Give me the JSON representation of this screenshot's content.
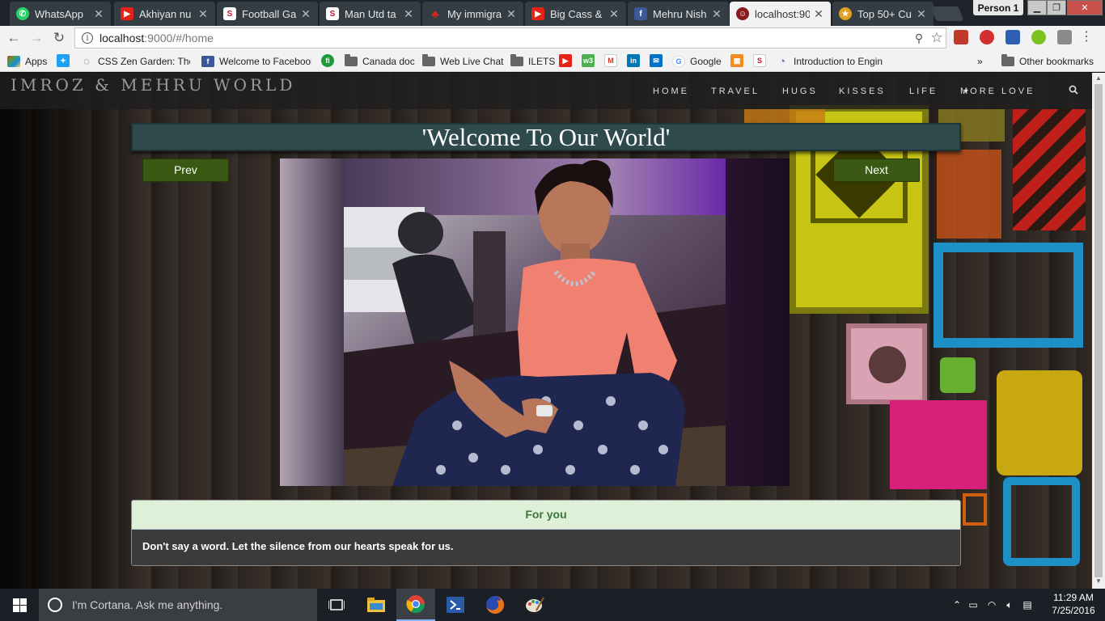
{
  "browser": {
    "tabs": [
      {
        "title": "WhatsApp",
        "icon": "whatsapp-icon",
        "color": "#25d366"
      },
      {
        "title": "Akhiyan nu",
        "icon": "youtube-icon",
        "color": "#e62117"
      },
      {
        "title": "Football Ga",
        "icon": "s-logo-icon",
        "color": "#c4122e"
      },
      {
        "title": "Man Utd ta",
        "icon": "s-logo-icon",
        "color": "#c4122e"
      },
      {
        "title": "My immigra",
        "icon": "maple-leaf-icon",
        "color": "#d52b1e"
      },
      {
        "title": "Big Cass &",
        "icon": "youtube-icon",
        "color": "#e62117"
      },
      {
        "title": "Mehru Nish",
        "icon": "facebook-icon",
        "color": "#3b5998"
      },
      {
        "title": "localhost:90",
        "icon": "site-icon",
        "color": "#8b1a1a"
      },
      {
        "title": "Top 50+ Cu",
        "icon": "star-badge-icon",
        "color": "#e0a020"
      }
    ],
    "profile": "Person 1",
    "url_host": "localhost",
    "url_rest": ":9000/#/home",
    "bookmarks": [
      {
        "label": "Apps",
        "icon": "apps-grid-icon"
      },
      {
        "label": "",
        "icon": "twitter-icon"
      },
      {
        "label": "CSS Zen Garden: The",
        "icon": "zen-icon"
      },
      {
        "label": "Welcome to Facebook",
        "icon": "facebook-icon"
      },
      {
        "label": "",
        "icon": "fi-icon"
      },
      {
        "label": "Canada doc",
        "icon": "folder-icon"
      },
      {
        "label": "Web Live Chat",
        "icon": "folder-icon"
      },
      {
        "label": "ILETS",
        "icon": "folder-icon"
      },
      {
        "label": "Google",
        "icon": "google-icon"
      },
      {
        "label": "Introduction to Engin",
        "icon": "loader-icon"
      }
    ],
    "overflow_label": "»",
    "other_bookmarks": "Other bookmarks"
  },
  "site": {
    "brand": "IMROZ & MEHRU WORLD",
    "nav": [
      "HOME",
      "TRAVEL",
      "HUGS",
      "KISSES",
      "LIFE",
      "MORE LOVE"
    ],
    "heading": "'Welcome To Our World'",
    "prev_label": "Prev",
    "next_label": "Next",
    "panel_title": "For you",
    "panel_text": "Don't say a word. Let the silence from our hearts speak for us."
  },
  "taskbar": {
    "search_placeholder": "I'm Cortana. Ask me anything.",
    "time": "11:29 AM",
    "date": "7/25/2016"
  },
  "colors": {
    "heading_bg": "#2e4a4c",
    "button_bg": "#3a5a13",
    "panel_head_bg": "#dff0d8",
    "panel_head_text": "#3c763d"
  }
}
